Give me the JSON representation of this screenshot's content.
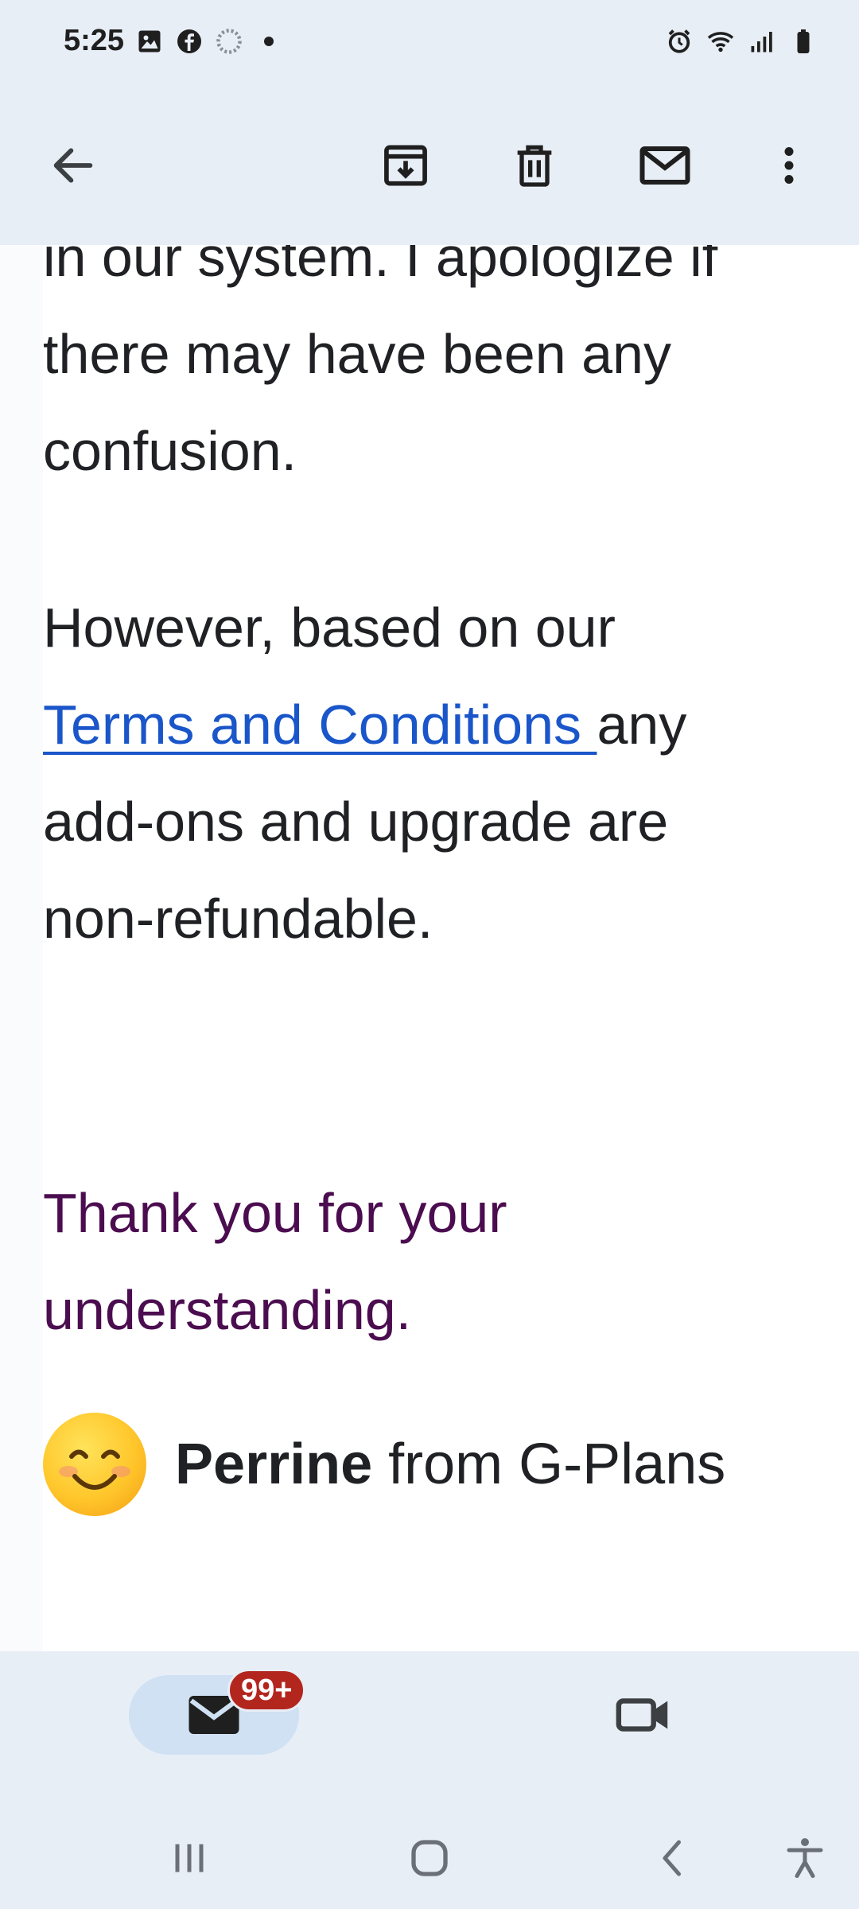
{
  "status_bar": {
    "time": "5:25",
    "left_icons": [
      "gallery-icon",
      "facebook-icon",
      "loading-icon",
      "dot-icon"
    ],
    "right_icons": [
      "alarm-icon",
      "wifi-icon",
      "signal-icon",
      "battery-icon"
    ]
  },
  "app_bar": {
    "actions": [
      "back-arrow-icon",
      "archive-icon",
      "delete-icon",
      "mark-unread-icon",
      "more-vert-icon"
    ]
  },
  "email": {
    "partial_line": "in our system. I apologize if",
    "line2": "there may have been any",
    "line3": "confusion.",
    "para2_line1": "However, based on our",
    "link_text": "Terms and Conditions ",
    "para2_after_link": "any",
    "para2_line3": "add-ons and upgrade are",
    "para2_line4": "non-refundable.",
    "thanks_line1": "Thank you for your",
    "thanks_line2": "understanding.",
    "signature_name": "Perrine",
    "signature_rest": " from G-Plans",
    "signature_emoji": "smiling-face-emoji"
  },
  "bottom_nav": {
    "mail_badge": "99+",
    "tabs": [
      "mail-icon",
      "video-icon"
    ]
  },
  "system_nav": [
    "recents-icon",
    "home-icon",
    "back-icon",
    "accessibility-icon"
  ],
  "colors": {
    "chrome_bg": "#e8eef6",
    "link": "#1a56c9",
    "purple_text": "#4b0d4f",
    "badge": "#b3261e",
    "active_tab": "#cfe1f3"
  }
}
